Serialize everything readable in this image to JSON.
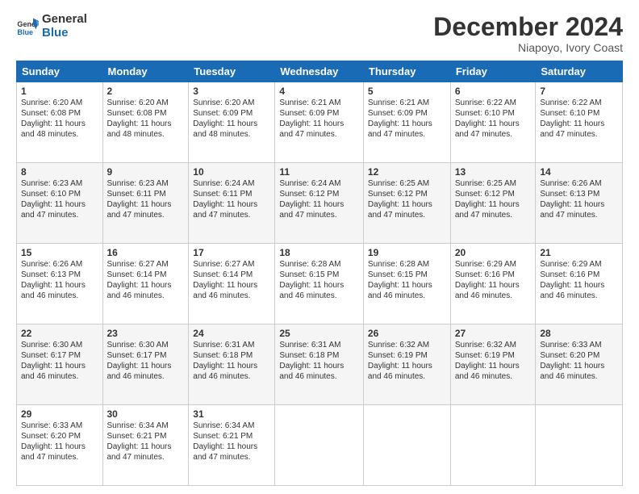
{
  "logo": {
    "line1": "General",
    "line2": "Blue"
  },
  "title": "December 2024",
  "subtitle": "Niapoyo, Ivory Coast",
  "weekdays": [
    "Sunday",
    "Monday",
    "Tuesday",
    "Wednesday",
    "Thursday",
    "Friday",
    "Saturday"
  ],
  "weeks": [
    [
      {
        "day": "1",
        "sunrise": "6:20 AM",
        "sunset": "6:08 PM",
        "daylight": "11 hours and 48 minutes."
      },
      {
        "day": "2",
        "sunrise": "6:20 AM",
        "sunset": "6:08 PM",
        "daylight": "11 hours and 48 minutes."
      },
      {
        "day": "3",
        "sunrise": "6:20 AM",
        "sunset": "6:09 PM",
        "daylight": "11 hours and 48 minutes."
      },
      {
        "day": "4",
        "sunrise": "6:21 AM",
        "sunset": "6:09 PM",
        "daylight": "11 hours and 47 minutes."
      },
      {
        "day": "5",
        "sunrise": "6:21 AM",
        "sunset": "6:09 PM",
        "daylight": "11 hours and 47 minutes."
      },
      {
        "day": "6",
        "sunrise": "6:22 AM",
        "sunset": "6:10 PM",
        "daylight": "11 hours and 47 minutes."
      },
      {
        "day": "7",
        "sunrise": "6:22 AM",
        "sunset": "6:10 PM",
        "daylight": "11 hours and 47 minutes."
      }
    ],
    [
      {
        "day": "8",
        "sunrise": "6:23 AM",
        "sunset": "6:10 PM",
        "daylight": "11 hours and 47 minutes."
      },
      {
        "day": "9",
        "sunrise": "6:23 AM",
        "sunset": "6:11 PM",
        "daylight": "11 hours and 47 minutes."
      },
      {
        "day": "10",
        "sunrise": "6:24 AM",
        "sunset": "6:11 PM",
        "daylight": "11 hours and 47 minutes."
      },
      {
        "day": "11",
        "sunrise": "6:24 AM",
        "sunset": "6:12 PM",
        "daylight": "11 hours and 47 minutes."
      },
      {
        "day": "12",
        "sunrise": "6:25 AM",
        "sunset": "6:12 PM",
        "daylight": "11 hours and 47 minutes."
      },
      {
        "day": "13",
        "sunrise": "6:25 AM",
        "sunset": "6:12 PM",
        "daylight": "11 hours and 47 minutes."
      },
      {
        "day": "14",
        "sunrise": "6:26 AM",
        "sunset": "6:13 PM",
        "daylight": "11 hours and 47 minutes."
      }
    ],
    [
      {
        "day": "15",
        "sunrise": "6:26 AM",
        "sunset": "6:13 PM",
        "daylight": "11 hours and 46 minutes."
      },
      {
        "day": "16",
        "sunrise": "6:27 AM",
        "sunset": "6:14 PM",
        "daylight": "11 hours and 46 minutes."
      },
      {
        "day": "17",
        "sunrise": "6:27 AM",
        "sunset": "6:14 PM",
        "daylight": "11 hours and 46 minutes."
      },
      {
        "day": "18",
        "sunrise": "6:28 AM",
        "sunset": "6:15 PM",
        "daylight": "11 hours and 46 minutes."
      },
      {
        "day": "19",
        "sunrise": "6:28 AM",
        "sunset": "6:15 PM",
        "daylight": "11 hours and 46 minutes."
      },
      {
        "day": "20",
        "sunrise": "6:29 AM",
        "sunset": "6:16 PM",
        "daylight": "11 hours and 46 minutes."
      },
      {
        "day": "21",
        "sunrise": "6:29 AM",
        "sunset": "6:16 PM",
        "daylight": "11 hours and 46 minutes."
      }
    ],
    [
      {
        "day": "22",
        "sunrise": "6:30 AM",
        "sunset": "6:17 PM",
        "daylight": "11 hours and 46 minutes."
      },
      {
        "day": "23",
        "sunrise": "6:30 AM",
        "sunset": "6:17 PM",
        "daylight": "11 hours and 46 minutes."
      },
      {
        "day": "24",
        "sunrise": "6:31 AM",
        "sunset": "6:18 PM",
        "daylight": "11 hours and 46 minutes."
      },
      {
        "day": "25",
        "sunrise": "6:31 AM",
        "sunset": "6:18 PM",
        "daylight": "11 hours and 46 minutes."
      },
      {
        "day": "26",
        "sunrise": "6:32 AM",
        "sunset": "6:19 PM",
        "daylight": "11 hours and 46 minutes."
      },
      {
        "day": "27",
        "sunrise": "6:32 AM",
        "sunset": "6:19 PM",
        "daylight": "11 hours and 46 minutes."
      },
      {
        "day": "28",
        "sunrise": "6:33 AM",
        "sunset": "6:20 PM",
        "daylight": "11 hours and 46 minutes."
      }
    ],
    [
      {
        "day": "29",
        "sunrise": "6:33 AM",
        "sunset": "6:20 PM",
        "daylight": "11 hours and 47 minutes."
      },
      {
        "day": "30",
        "sunrise": "6:34 AM",
        "sunset": "6:21 PM",
        "daylight": "11 hours and 47 minutes."
      },
      {
        "day": "31",
        "sunrise": "6:34 AM",
        "sunset": "6:21 PM",
        "daylight": "11 hours and 47 minutes."
      },
      null,
      null,
      null,
      null
    ]
  ],
  "labels": {
    "sunrise": "Sunrise:",
    "sunset": "Sunset:",
    "daylight": "Daylight:"
  }
}
